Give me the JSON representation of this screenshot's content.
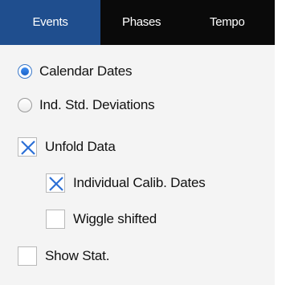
{
  "tabs": [
    {
      "label": "Events",
      "active": true
    },
    {
      "label": "Phases",
      "active": false
    },
    {
      "label": "Tempo",
      "active": false
    }
  ],
  "options": {
    "calendar_dates": {
      "label": "Calendar Dates",
      "selected": true
    },
    "ind_std_deviations": {
      "label": "Ind. Std. Deviations",
      "selected": false
    },
    "unfold_data": {
      "label": "Unfold Data",
      "checked": true
    },
    "individual_calib_dates": {
      "label": "Individual Calib. Dates",
      "checked": true
    },
    "wiggle_shifted": {
      "label": "Wiggle shifted",
      "checked": false
    },
    "show_stat": {
      "label": "Show Stat.",
      "checked": false
    }
  },
  "colors": {
    "tab_active": "#1f4e8e",
    "tab_bar": "#0a0a0a",
    "check_mark": "#2c6fd6",
    "radio_fill": "#1c63c8"
  }
}
